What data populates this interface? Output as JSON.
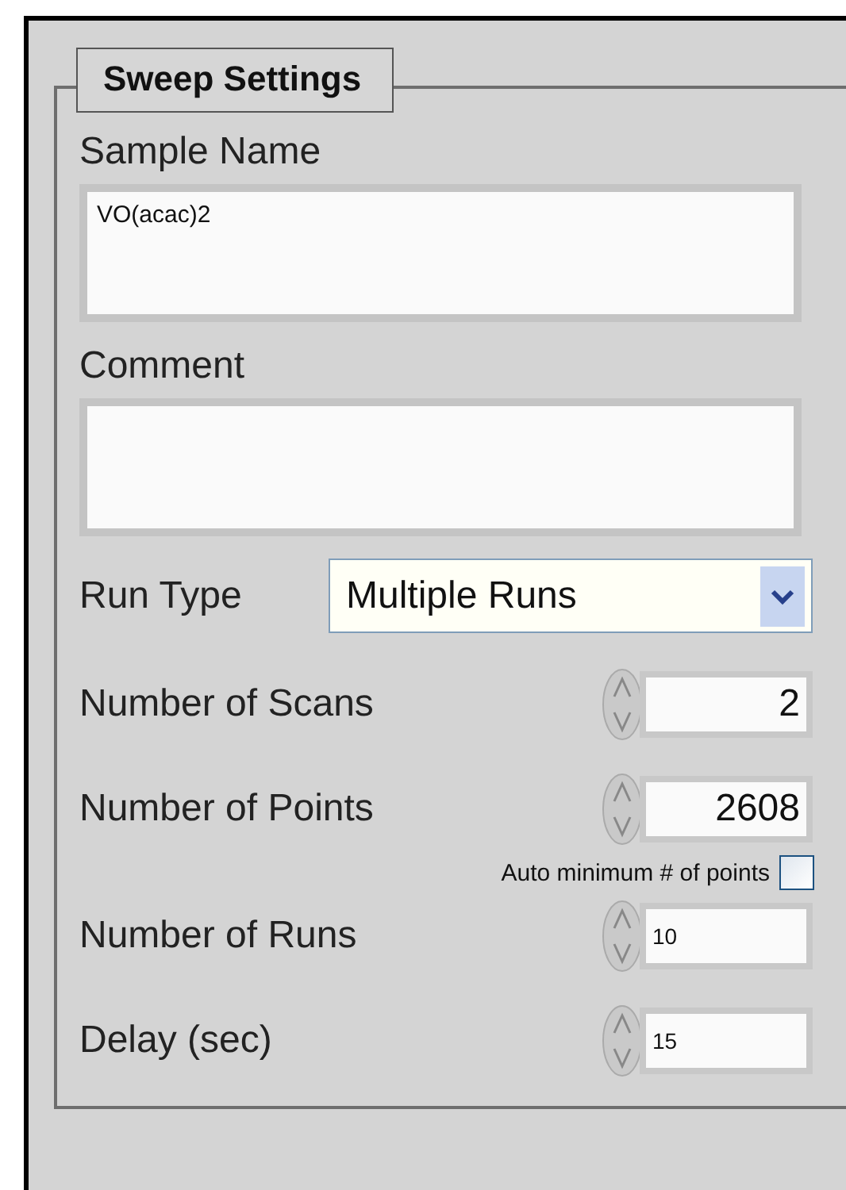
{
  "group": {
    "title": "Sweep Settings"
  },
  "sample_name": {
    "label": "Sample Name",
    "value": "VO(acac)2"
  },
  "comment": {
    "label": "Comment"
  },
  "run_type": {
    "label": "Run Type",
    "value": "Multiple Runs"
  },
  "numerics": [
    {
      "kind": "large",
      "label": "Number of Scans",
      "value": "2"
    },
    {
      "kind": "large",
      "label": "Number of Points",
      "value": "2608"
    },
    {
      "kind": "checkbox",
      "label": "Auto minimum # of points",
      "checked": false
    },
    {
      "kind": "small",
      "label": "Number of Runs",
      "value": "10"
    },
    {
      "kind": "small",
      "label": "Delay (sec)",
      "value": "15"
    }
  ]
}
